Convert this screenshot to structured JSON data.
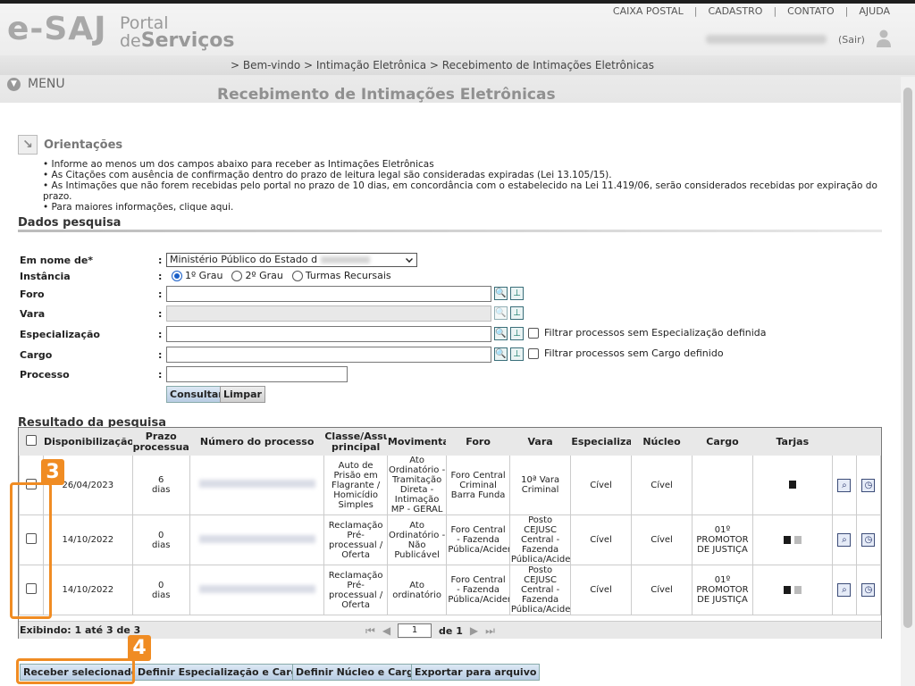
{
  "header": {
    "logo_main": "e-SAJ",
    "logo_portal_line1": "Portal",
    "logo_portal_line2_de": "de",
    "logo_portal_line2": "Serviços",
    "top_links": [
      "CAIXA POSTAL",
      "CADASTRO",
      "CONTATO",
      "AJUDA"
    ],
    "logout_label": "(Sair)"
  },
  "breadcrumb": "> Bem-vindo > Intimação Eletrônica > Recebimento de Intimações Eletrônicas",
  "menu_label": "MENU",
  "page_title": "Recebimento de Intimações Eletrônicas",
  "orientacoes": {
    "title": "Orientações",
    "items": [
      "Informe ao menos um dos campos abaixo para receber as Intimações Eletrônicas",
      "As Citações com ausência de confirmação dentro do prazo de leitura legal são consideradas expiradas (Lei 13.105/15).",
      "As Intimações que não forem recebidas pelo portal no prazo de 10 dias, em concordância com o estabelecido na Lei 11.419/06, serão considerados recebidas por expiração do prazo.",
      "Para maiores informações, clique aqui."
    ]
  },
  "search": {
    "title": "Dados pesquisa",
    "labels": {
      "em_nome_de": "Em nome de*",
      "instancia": "Instância",
      "foro": "Foro",
      "vara": "Vara",
      "especializacao": "Especialização",
      "cargo": "Cargo",
      "processo": "Processo"
    },
    "em_nome_de_value": "Ministério Público do Estado d",
    "instancia_options": [
      "1º Grau",
      "2º Grau",
      "Turmas Recursais"
    ],
    "filter_especializacao": "Filtrar processos sem Especialização definida",
    "filter_cargo": "Filtrar processos sem Cargo definido",
    "btn_consultar": "Consultar",
    "btn_limpar": "Limpar"
  },
  "results": {
    "title": "Resultado da pesquisa",
    "columns": [
      "Disponibilização",
      "Prazo processual",
      "Número do processo",
      "Classe/Assunto principal",
      "Movimentação",
      "Foro",
      "Vara",
      "Especialização",
      "Núcleo",
      "Cargo",
      "Tarjas"
    ],
    "rows": [
      {
        "data": "26/04/2023",
        "prazo": "6",
        "prazo_unit": "dias",
        "classe": "Auto de Prisão em Flagrante / Homicídio Simples",
        "mov": "Ato Ordinatório - Tramitação Direta - Intimação MP - GERAL",
        "foro": "Foro Central Criminal Barra Funda",
        "vara": "10ª Vara Criminal",
        "esp": "Cível",
        "nucleo": "Cível",
        "cargo": "",
        "tarjas": [
          "black"
        ]
      },
      {
        "data": "14/10/2022",
        "prazo": "0",
        "prazo_unit": "dias",
        "classe": "Reclamação Pré-processual / Oferta",
        "mov": "Ato Ordinatório - Não Publicável",
        "foro": "Foro Central - Fazenda Pública/Acidentes",
        "vara": "Posto CEJUSC Central - Fazenda Pública/Acidentes",
        "esp": "Cível",
        "nucleo": "Cível",
        "cargo": "01º PROMOTOR DE JUSTIÇA",
        "tarjas": [
          "black",
          "grey"
        ]
      },
      {
        "data": "14/10/2022",
        "prazo": "0",
        "prazo_unit": "dias",
        "classe": "Reclamação Pré-processual / Oferta",
        "mov": "Ato ordinatório",
        "foro": "Foro Central - Fazenda Pública/Acidentes",
        "vara": "Posto CEJUSC Central - Fazenda Pública/Acidentes",
        "esp": "Cível",
        "nucleo": "Cível",
        "cargo": "01º PROMOTOR DE JUSTIÇA",
        "tarjas": [
          "black",
          "grey"
        ]
      }
    ],
    "footer_text": "Exibindo: 1 até 3 de 3",
    "page_value": "1",
    "page_of": "de 1"
  },
  "actions": {
    "receber": "Receber selecionados",
    "definir_esp_cargo": "Definir Especialização e Cargo",
    "definir_nucleo_cargo": "Definir Núcleo e Cargo",
    "exportar": "Exportar para arquivo"
  },
  "annotations": {
    "badge_3": "3",
    "badge_4": "4",
    "color": "#f08c23"
  }
}
